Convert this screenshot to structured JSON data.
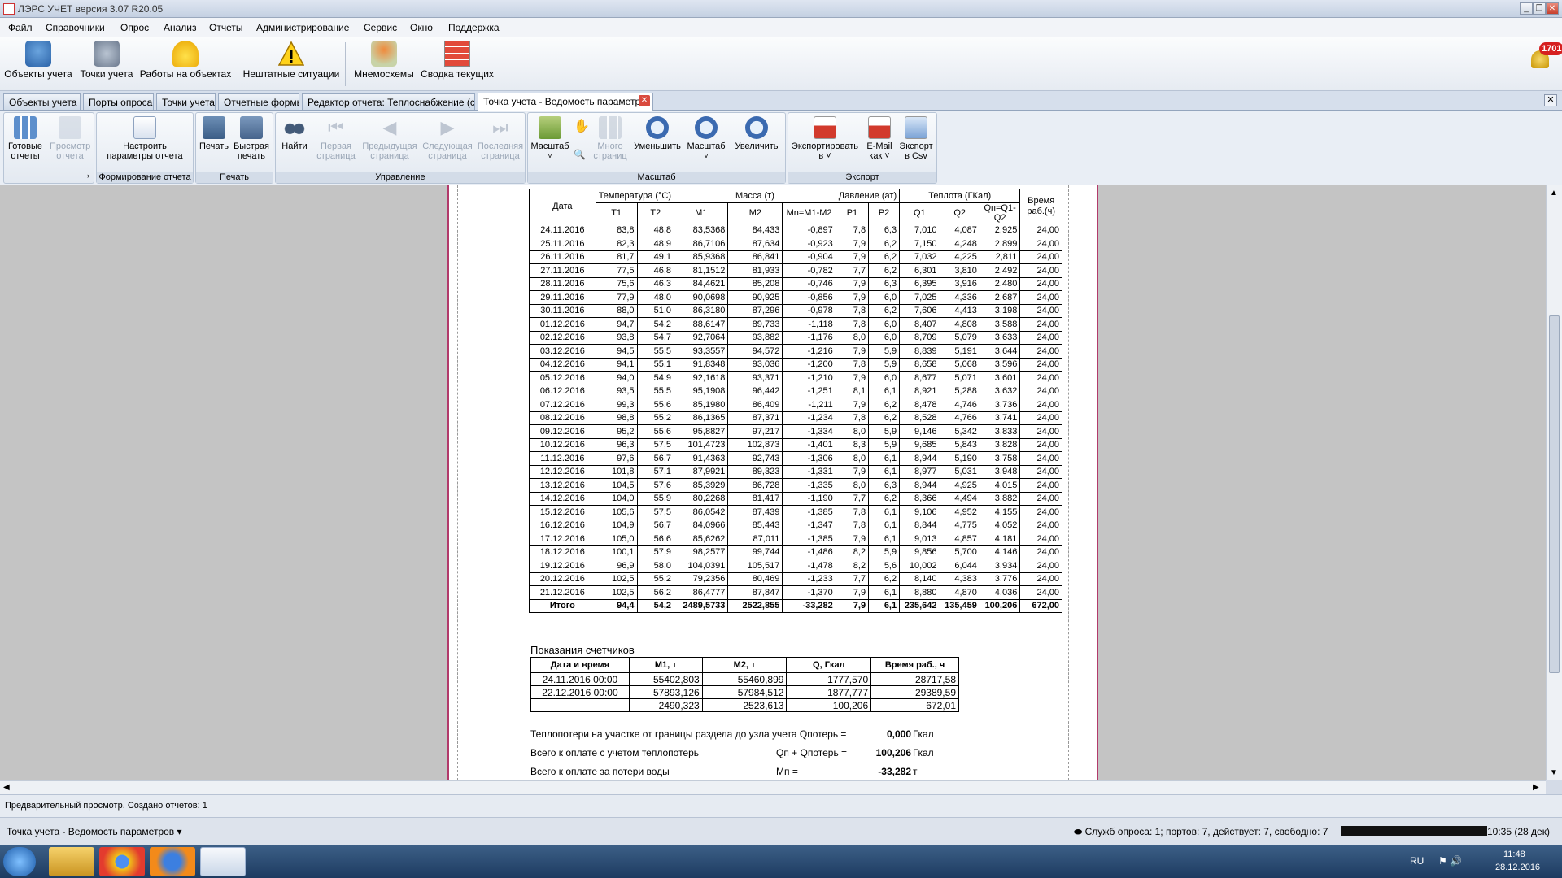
{
  "app": {
    "title": "ЛЭРС УЧЕТ версия 3.07 R20.05"
  },
  "menu": [
    "Файл",
    "Справочники",
    "Опрос",
    "Анализ",
    "Отчеты",
    "Администрирование",
    "Сервис",
    "Окно",
    "Поддержка"
  ],
  "toolbar": {
    "items": [
      "Объекты учета",
      "Точки учета",
      "Работы на объектах",
      "Нештатные ситуации",
      "Мнемосхемы",
      "Сводка текущих"
    ],
    "notification_count": "1701"
  },
  "tabs": [
    "Объекты учета",
    "Порты опроса",
    "Точки учета",
    "Отчетные формы",
    "Редактор отчета: Теплоснабжение (сх",
    "Точка учета - Ведомость параметр"
  ],
  "ribbon": {
    "groups": [
      "Формирование отчета",
      "Печать",
      "Управление",
      "Масштаб",
      "Экспорт"
    ],
    "buttons": {
      "ready_reports": [
        "Готовые",
        "отчеты"
      ],
      "preview_report": [
        "Просмотр",
        "отчета"
      ],
      "setup_params": [
        "Настроить",
        "параметры отчета"
      ],
      "print": "Печать",
      "quick_print": [
        "Быстрая",
        "печать"
      ],
      "find": "Найти",
      "first_page": [
        "Первая",
        "страница"
      ],
      "prev_page": [
        "Предыдущая",
        "страница"
      ],
      "next_page": [
        "Следующая",
        "страница"
      ],
      "last_page": [
        "Последняя",
        "страница"
      ],
      "zoom_tool": "Масштаб",
      "many_pages": [
        "Много",
        "страниц"
      ],
      "zoom_out": "Уменьшить",
      "zoom": "Масштаб",
      "zoom_in": "Увеличить",
      "export_to": [
        "Экспортировать",
        "в"
      ],
      "email_as": [
        "E-Mail",
        "как"
      ],
      "export_csv": [
        "Экспорт",
        "в Csv"
      ]
    }
  },
  "report": {
    "headers": {
      "date": "Дата",
      "temp": "Температура (°С)",
      "mass": "Масса (т)",
      "pressure": "Давление (ат)",
      "heat": "Теплота (ГКал)",
      "worktime": "Время раб.(ч)",
      "t1": "T1",
      "t2": "T2",
      "m1": "M1",
      "m2": "M2",
      "mn": "Mn=M1-M2",
      "p1": "P1",
      "p2": "P2",
      "q1": "Q1",
      "q2": "Q2",
      "qn": "Qп=Q1-Q2"
    },
    "rows": [
      [
        "24.11.2016",
        "83,8",
        "48,8",
        "83,5368",
        "84,433",
        "-0,897",
        "7,8",
        "6,3",
        "7,010",
        "4,087",
        "2,925",
        "24,00"
      ],
      [
        "25.11.2016",
        "82,3",
        "48,9",
        "86,7106",
        "87,634",
        "-0,923",
        "7,9",
        "6,2",
        "7,150",
        "4,248",
        "2,899",
        "24,00"
      ],
      [
        "26.11.2016",
        "81,7",
        "49,1",
        "85,9368",
        "86,841",
        "-0,904",
        "7,9",
        "6,2",
        "7,032",
        "4,225",
        "2,811",
        "24,00"
      ],
      [
        "27.11.2016",
        "77,5",
        "46,8",
        "81,1512",
        "81,933",
        "-0,782",
        "7,7",
        "6,2",
        "6,301",
        "3,810",
        "2,492",
        "24,00"
      ],
      [
        "28.11.2016",
        "75,6",
        "46,3",
        "84,4621",
        "85,208",
        "-0,746",
        "7,9",
        "6,3",
        "6,395",
        "3,916",
        "2,480",
        "24,00"
      ],
      [
        "29.11.2016",
        "77,9",
        "48,0",
        "90,0698",
        "90,925",
        "-0,856",
        "7,9",
        "6,0",
        "7,025",
        "4,336",
        "2,687",
        "24,00"
      ],
      [
        "30.11.2016",
        "88,0",
        "51,0",
        "86,3180",
        "87,296",
        "-0,978",
        "7,8",
        "6,2",
        "7,606",
        "4,413",
        "3,198",
        "24,00"
      ],
      [
        "01.12.2016",
        "94,7",
        "54,2",
        "88,6147",
        "89,733",
        "-1,118",
        "7,8",
        "6,0",
        "8,407",
        "4,808",
        "3,588",
        "24,00"
      ],
      [
        "02.12.2016",
        "93,8",
        "54,7",
        "92,7064",
        "93,882",
        "-1,176",
        "8,0",
        "6,0",
        "8,709",
        "5,079",
        "3,633",
        "24,00"
      ],
      [
        "03.12.2016",
        "94,5",
        "55,5",
        "93,3557",
        "94,572",
        "-1,216",
        "7,9",
        "5,9",
        "8,839",
        "5,191",
        "3,644",
        "24,00"
      ],
      [
        "04.12.2016",
        "94,1",
        "55,1",
        "91,8348",
        "93,036",
        "-1,200",
        "7,8",
        "5,9",
        "8,658",
        "5,068",
        "3,596",
        "24,00"
      ],
      [
        "05.12.2016",
        "94,0",
        "54,9",
        "92,1618",
        "93,371",
        "-1,210",
        "7,9",
        "6,0",
        "8,677",
        "5,071",
        "3,601",
        "24,00"
      ],
      [
        "06.12.2016",
        "93,5",
        "55,5",
        "95,1908",
        "96,442",
        "-1,251",
        "8,1",
        "6,1",
        "8,921",
        "5,288",
        "3,632",
        "24,00"
      ],
      [
        "07.12.2016",
        "99,3",
        "55,6",
        "85,1980",
        "86,409",
        "-1,211",
        "7,9",
        "6,2",
        "8,478",
        "4,746",
        "3,736",
        "24,00"
      ],
      [
        "08.12.2016",
        "98,8",
        "55,2",
        "86,1365",
        "87,371",
        "-1,234",
        "7,8",
        "6,2",
        "8,528",
        "4,766",
        "3,741",
        "24,00"
      ],
      [
        "09.12.2016",
        "95,2",
        "55,6",
        "95,8827",
        "97,217",
        "-1,334",
        "8,0",
        "5,9",
        "9,146",
        "5,342",
        "3,833",
        "24,00"
      ],
      [
        "10.12.2016",
        "96,3",
        "57,5",
        "101,4723",
        "102,873",
        "-1,401",
        "8,3",
        "5,9",
        "9,685",
        "5,843",
        "3,828",
        "24,00"
      ],
      [
        "11.12.2016",
        "97,6",
        "56,7",
        "91,4363",
        "92,743",
        "-1,306",
        "8,0",
        "6,1",
        "8,944",
        "5,190",
        "3,758",
        "24,00"
      ],
      [
        "12.12.2016",
        "101,8",
        "57,1",
        "87,9921",
        "89,323",
        "-1,331",
        "7,9",
        "6,1",
        "8,977",
        "5,031",
        "3,948",
        "24,00"
      ],
      [
        "13.12.2016",
        "104,5",
        "57,6",
        "85,3929",
        "86,728",
        "-1,335",
        "8,0",
        "6,3",
        "8,944",
        "4,925",
        "4,015",
        "24,00"
      ],
      [
        "14.12.2016",
        "104,0",
        "55,9",
        "80,2268",
        "81,417",
        "-1,190",
        "7,7",
        "6,2",
        "8,366",
        "4,494",
        "3,882",
        "24,00"
      ],
      [
        "15.12.2016",
        "105,6",
        "57,5",
        "86,0542",
        "87,439",
        "-1,385",
        "7,8",
        "6,1",
        "9,106",
        "4,952",
        "4,155",
        "24,00"
      ],
      [
        "16.12.2016",
        "104,9",
        "56,7",
        "84,0966",
        "85,443",
        "-1,347",
        "7,8",
        "6,1",
        "8,844",
        "4,775",
        "4,052",
        "24,00"
      ],
      [
        "17.12.2016",
        "105,0",
        "56,6",
        "85,6262",
        "87,011",
        "-1,385",
        "7,9",
        "6,1",
        "9,013",
        "4,857",
        "4,181",
        "24,00"
      ],
      [
        "18.12.2016",
        "100,1",
        "57,9",
        "98,2577",
        "99,744",
        "-1,486",
        "8,2",
        "5,9",
        "9,856",
        "5,700",
        "4,146",
        "24,00"
      ],
      [
        "19.12.2016",
        "96,9",
        "58,0",
        "104,0391",
        "105,517",
        "-1,478",
        "8,2",
        "5,6",
        "10,002",
        "6,044",
        "3,934",
        "24,00"
      ],
      [
        "20.12.2016",
        "102,5",
        "55,2",
        "79,2356",
        "80,469",
        "-1,233",
        "7,7",
        "6,2",
        "8,140",
        "4,383",
        "3,776",
        "24,00"
      ],
      [
        "21.12.2016",
        "102,5",
        "56,2",
        "86,4777",
        "87,847",
        "-1,370",
        "7,9",
        "6,1",
        "8,880",
        "4,870",
        "4,036",
        "24,00"
      ]
    ],
    "total": [
      "Итого",
      "94,4",
      "54,2",
      "2489,5733",
      "2522,855",
      "-33,282",
      "7,9",
      "6,1",
      "235,642",
      "135,459",
      "100,206",
      "672,00"
    ],
    "meters_title": "Показания счетчиков",
    "meters_headers": [
      "Дата и время",
      "M1, т",
      "M2, т",
      "Q, Гкал",
      "Время раб., ч"
    ],
    "meters_rows": [
      [
        "24.11.2016  00:00",
        "55402,803",
        "55460,899",
        "1777,570",
        "28717,58"
      ],
      [
        "22.12.2016  00:00",
        "57893,126",
        "57984,512",
        "1877,777",
        "29389,59"
      ],
      [
        "",
        "2490,323",
        "2523,613",
        "100,206",
        "672,01"
      ]
    ],
    "summary": [
      {
        "label": "Теплопотери на участке от границы раздела до узла учета Qпотерь =",
        "formula": "",
        "value": "0,000",
        "unit": "Гкал"
      },
      {
        "label": "Всего к оплате с учетом теплопотерь",
        "formula": "Qп + Qпотерь  =",
        "value": "100,206",
        "unit": "Гкал"
      },
      {
        "label": "Всего к оплате за потери воды",
        "formula": "Мп =",
        "value": "-33,282",
        "unit": "т"
      }
    ]
  },
  "status": {
    "line1": "Предварительный просмотр.  Создано отчетов: 1",
    "doc_selector": "Точка учета - Ведомость параметров",
    "services": "Служб опроса: 1; портов: 7, действует: 7, свободно: 7",
    "time_right": "10:35 (28 дек)"
  },
  "taskbar": {
    "lang": "RU",
    "time": "11:48",
    "date": "28.12.2016"
  }
}
